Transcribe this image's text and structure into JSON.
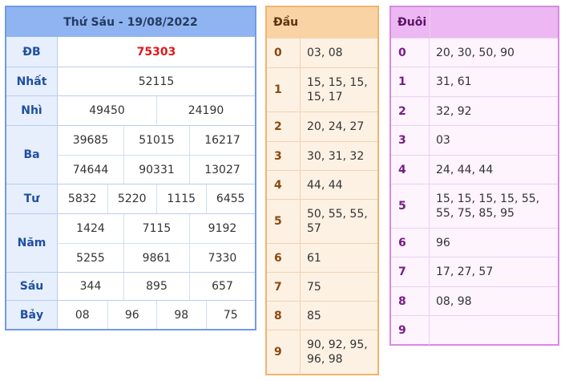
{
  "results": {
    "title": "Thứ Sáu - 19/08/2022",
    "rows": [
      {
        "label": "ĐB",
        "values": [
          "75303"
        ]
      },
      {
        "label": "Nhất",
        "values": [
          "52115"
        ]
      },
      {
        "label": "Nhì",
        "values": [
          "49450",
          "24190"
        ]
      },
      {
        "label": "Ba",
        "values": [
          "39685",
          "51015",
          "16217",
          "74644",
          "90331",
          "13027"
        ]
      },
      {
        "label": "Tư",
        "values": [
          "5832",
          "5220",
          "1115",
          "6455"
        ]
      },
      {
        "label": "Năm",
        "values": [
          "1424",
          "7115",
          "9192",
          "5255",
          "9861",
          "7330"
        ]
      },
      {
        "label": "Sáu",
        "values": [
          "344",
          "895",
          "657"
        ]
      },
      {
        "label": "Bảy",
        "values": [
          "08",
          "96",
          "98",
          "75"
        ]
      }
    ]
  },
  "dau": {
    "header": "Đầu",
    "rows": [
      {
        "key": "0",
        "value": "03, 08"
      },
      {
        "key": "1",
        "value": "15, 15, 15, 15, 17"
      },
      {
        "key": "2",
        "value": "20, 24, 27"
      },
      {
        "key": "3",
        "value": "30, 31, 32"
      },
      {
        "key": "4",
        "value": "44, 44"
      },
      {
        "key": "5",
        "value": "50, 55, 55, 57"
      },
      {
        "key": "6",
        "value": "61"
      },
      {
        "key": "7",
        "value": "75"
      },
      {
        "key": "8",
        "value": "85"
      },
      {
        "key": "9",
        "value": "90, 92, 95, 96, 98"
      }
    ]
  },
  "duoi": {
    "header": "Đuôi",
    "rows": [
      {
        "key": "0",
        "value": "20, 30, 50, 90"
      },
      {
        "key": "1",
        "value": "31, 61"
      },
      {
        "key": "2",
        "value": "32, 92"
      },
      {
        "key": "3",
        "value": "03"
      },
      {
        "key": "4",
        "value": "24, 44, 44"
      },
      {
        "key": "5",
        "value": "15, 15, 15, 15, 55, 55, 75, 85, 95"
      },
      {
        "key": "6",
        "value": "96"
      },
      {
        "key": "7",
        "value": "17, 27, 57"
      },
      {
        "key": "8",
        "value": "08, 98"
      },
      {
        "key": "9",
        "value": ""
      }
    ]
  },
  "colors": {
    "accent_blue": "#8fb4f1",
    "accent_orange": "#fad3a5",
    "accent_purple": "#ecb7f2",
    "special_prize": "#e01818"
  }
}
